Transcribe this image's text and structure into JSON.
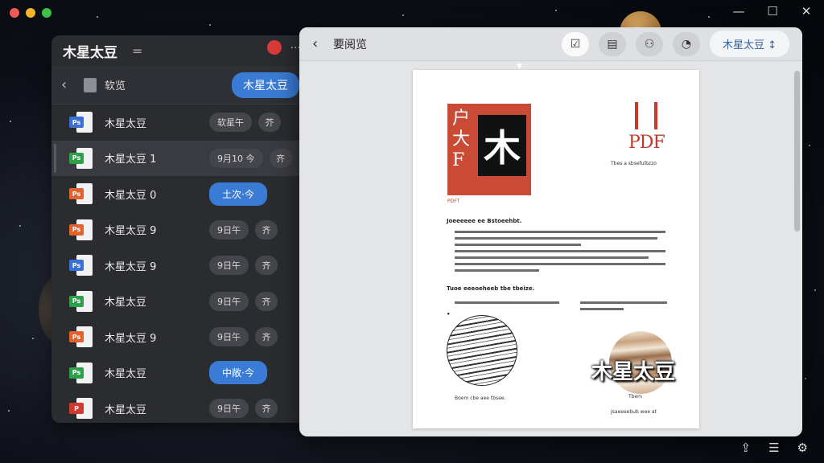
{
  "colors": {
    "accent": "#3a7bd5",
    "traffic_close": "#ee5b52",
    "traffic_min": "#f5b529",
    "traffic_max": "#3bc14a",
    "pdf_red": "#c94a35"
  },
  "left_panel": {
    "title": "木星太豆",
    "menu_icon": "menu-icon",
    "breadcrumb": "软览",
    "active_button": "木星太豆",
    "files": [
      {
        "name": "木星太豆",
        "tag": "Ps",
        "tag_color": "#3a6fd8",
        "pill": "软星午",
        "pill2": "芥",
        "blue": false,
        "selected": false
      },
      {
        "name": "木星太豆 1",
        "tag": "Ps",
        "tag_color": "#2ea04a",
        "pill": "9月10 今",
        "pill2": "齐",
        "blue": false,
        "selected": true
      },
      {
        "name": "木星太豆 0",
        "tag": "Ps",
        "tag_color": "#e2622d",
        "pill": "土次·今",
        "pill2": "",
        "blue": true,
        "selected": false
      },
      {
        "name": "木星太豆 9",
        "tag": "Ps",
        "tag_color": "#e2622d",
        "pill": "9日午",
        "pill2": "齐",
        "blue": false,
        "selected": false
      },
      {
        "name": "木星太豆 9",
        "tag": "Ps",
        "tag_color": "#3a6fd8",
        "pill": "9日午",
        "pill2": "齐",
        "blue": false,
        "selected": false
      },
      {
        "name": "木星太豆",
        "tag": "Ps",
        "tag_color": "#2ea04a",
        "pill": "9日午",
        "pill2": "齐",
        "blue": false,
        "selected": false
      },
      {
        "name": "木星太豆 9",
        "tag": "Ps",
        "tag_color": "#e2622d",
        "pill": "9日午",
        "pill2": "齐",
        "blue": false,
        "selected": false
      },
      {
        "name": "木星太豆",
        "tag": "Ps",
        "tag_color": "#2ea04a",
        "pill": "中敞·今",
        "pill2": "",
        "blue": true,
        "selected": false
      },
      {
        "name": "木星太豆",
        "tag": "P",
        "tag_color": "#d33a2f",
        "pill": "9日午",
        "pill2": "齐",
        "blue": false,
        "selected": false
      }
    ]
  },
  "preview": {
    "title": "要阅览",
    "file_button": "木星太豆 ↕",
    "tools": [
      "checkbox-icon",
      "comment-icon",
      "user-icon",
      "gauge-icon"
    ],
    "page": {
      "stamp_glyphs": "户\n大\nF",
      "stamp_main": "木",
      "stamp_caption": "PDFT",
      "pdf_label": "PDF",
      "pdf_subtitle": "Tbes a sbsefulbzzo",
      "section1": "Joeeeeee ee Bstoeehbt.",
      "section2": "Tuoe eeeoeheeb  tbe tbeize.",
      "caption_left": "Boem cbe aee tbsee.",
      "caption_right_top": "Tbem",
      "caption_right_bottom": "Jsaeeeebub wee at",
      "planet_label": "木星太豆"
    }
  }
}
